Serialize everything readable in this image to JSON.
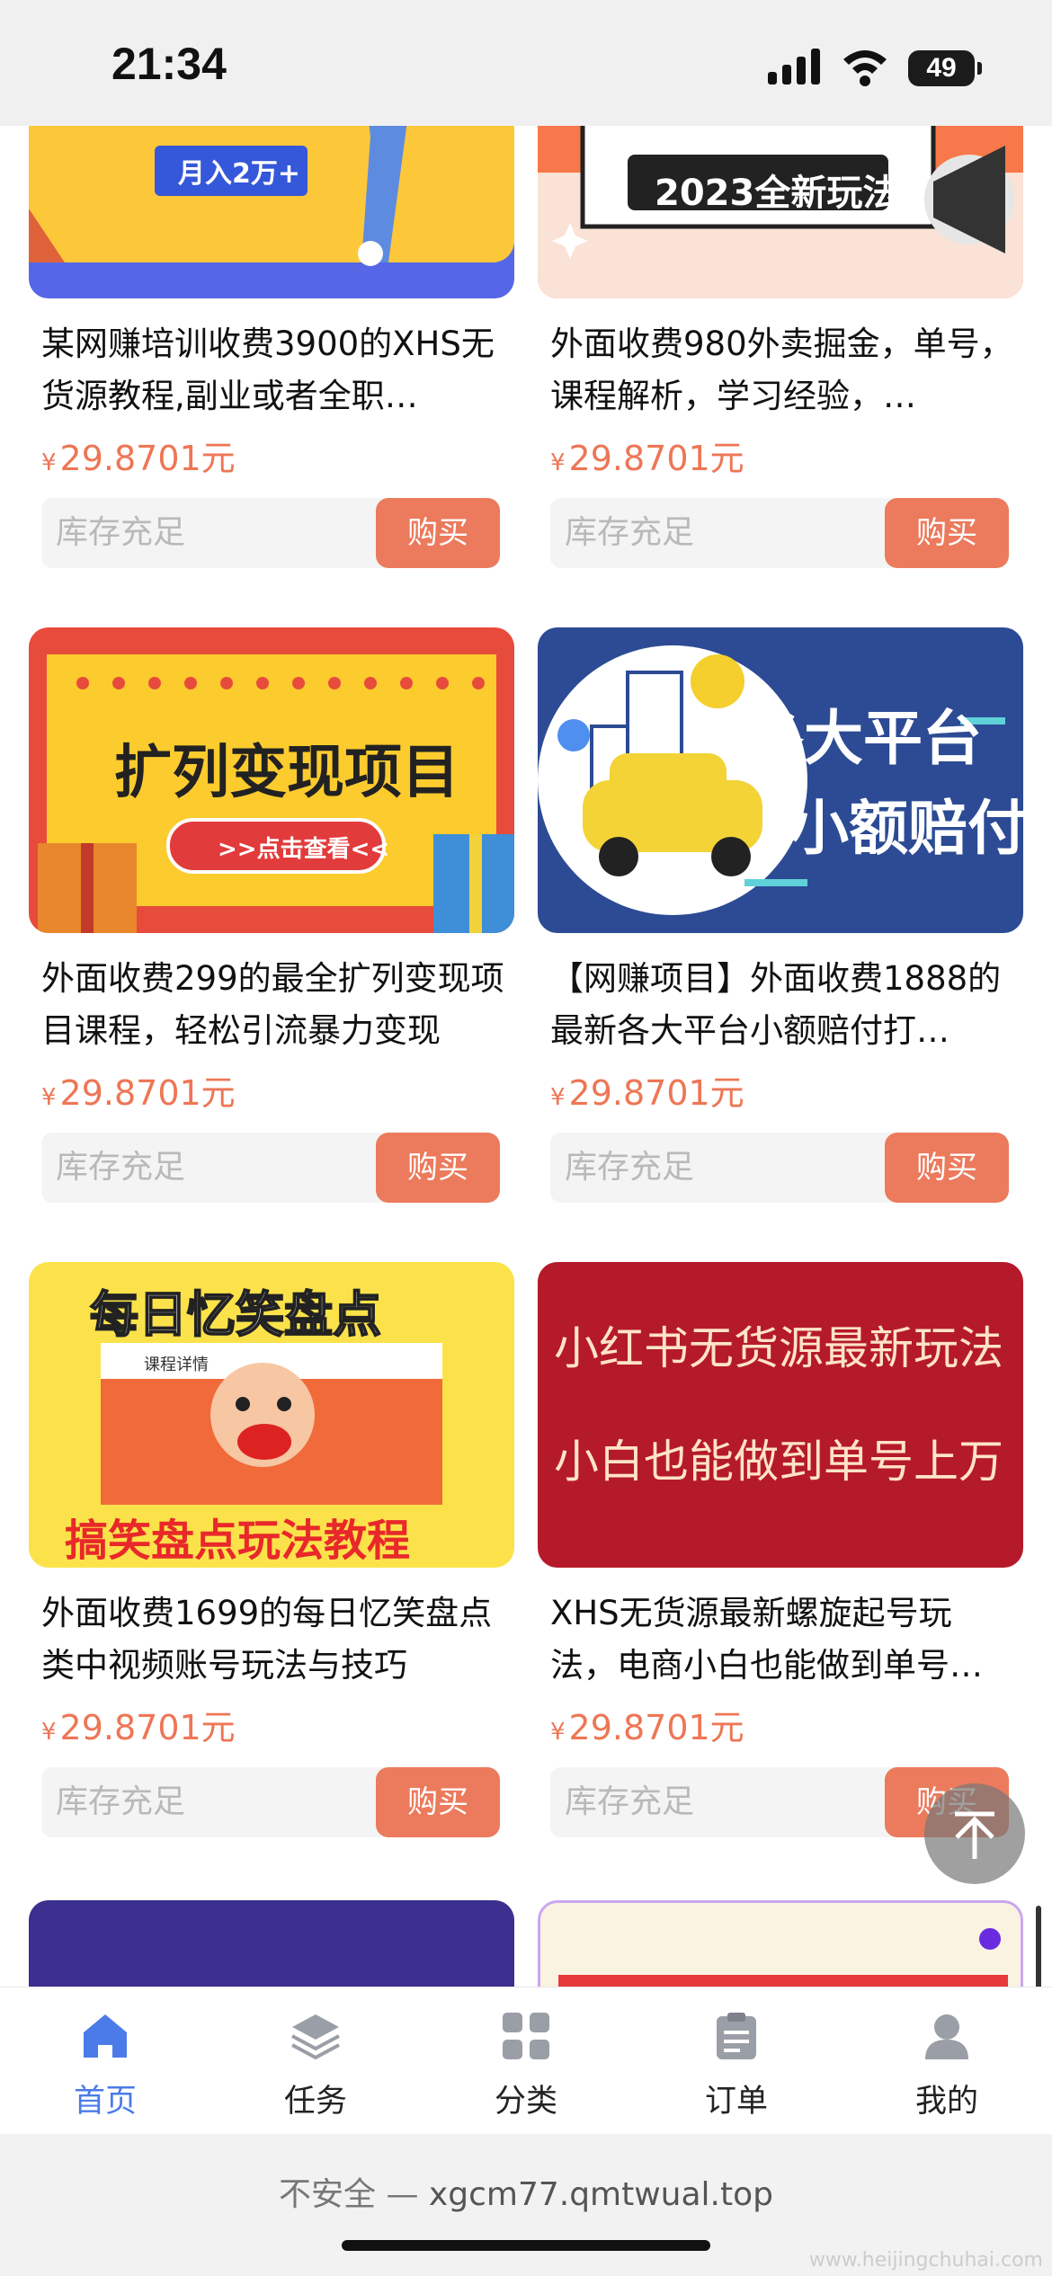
{
  "status": {
    "time": "21:34",
    "battery": "49"
  },
  "products": [
    {
      "title": "某网赚培训收费3900的XHS无货源教程,副业或者全职…",
      "price": "29.8701元",
      "stock": "库存充足",
      "buy": "购买",
      "thumb_text": "月入2万+"
    },
    {
      "title": "外面收费980外卖掘金，单号，课程解析，学习经验，…",
      "price": "29.8701元",
      "stock": "库存充足",
      "buy": "购买",
      "thumb_text": "2023全新玩法"
    },
    {
      "title": "外面收费299的最全扩列变现项目课程，轻松引流暴力变现",
      "price": "29.8701元",
      "stock": "库存充足",
      "buy": "购买",
      "thumb_text": "扩列变现项目",
      "thumb_sub": ">>点击查看<<"
    },
    {
      "title": "【网赚项目】外面收费1888的最新各大平台小额赔付打…",
      "price": "29.8701元",
      "stock": "库存充足",
      "buy": "购买",
      "thumb_text": "各大平台",
      "thumb_sub": "小额赔付"
    },
    {
      "title": "外面收费1699的每日忆笑盘点类中视频账号玩法与技巧",
      "price": "29.8701元",
      "stock": "库存充足",
      "buy": "购买",
      "thumb_text": "每日忆笑盘点",
      "thumb_sub": "搞笑盘点玩法教程",
      "thumb_inner": "课程详情"
    },
    {
      "title": "XHS无货源最新螺旋起号玩法，电商小白也能做到单号…",
      "price": "29.8701元",
      "stock": "库存充足",
      "buy": "购买",
      "thumb_text": "小红书无货源最新玩法",
      "thumb_sub": "小白也能做到单号上万"
    }
  ],
  "currency_symbol": "¥",
  "tabs": [
    {
      "label": "首页",
      "icon": "home-icon",
      "active": true
    },
    {
      "label": "任务",
      "icon": "layers-icon",
      "active": false
    },
    {
      "label": "分类",
      "icon": "grid-icon",
      "active": false
    },
    {
      "label": "订单",
      "icon": "clipboard-icon",
      "active": false
    },
    {
      "label": "我的",
      "icon": "user-icon",
      "active": false
    }
  ],
  "url_bar": {
    "prefix": "不安全 —",
    "host": "xgcm77.qmtwual.top"
  },
  "colors": {
    "accent": "#4a7be8",
    "price": "#ee7655",
    "buy_button": "#ec7a5c"
  },
  "watermark": "www.heijingchuhai.com"
}
